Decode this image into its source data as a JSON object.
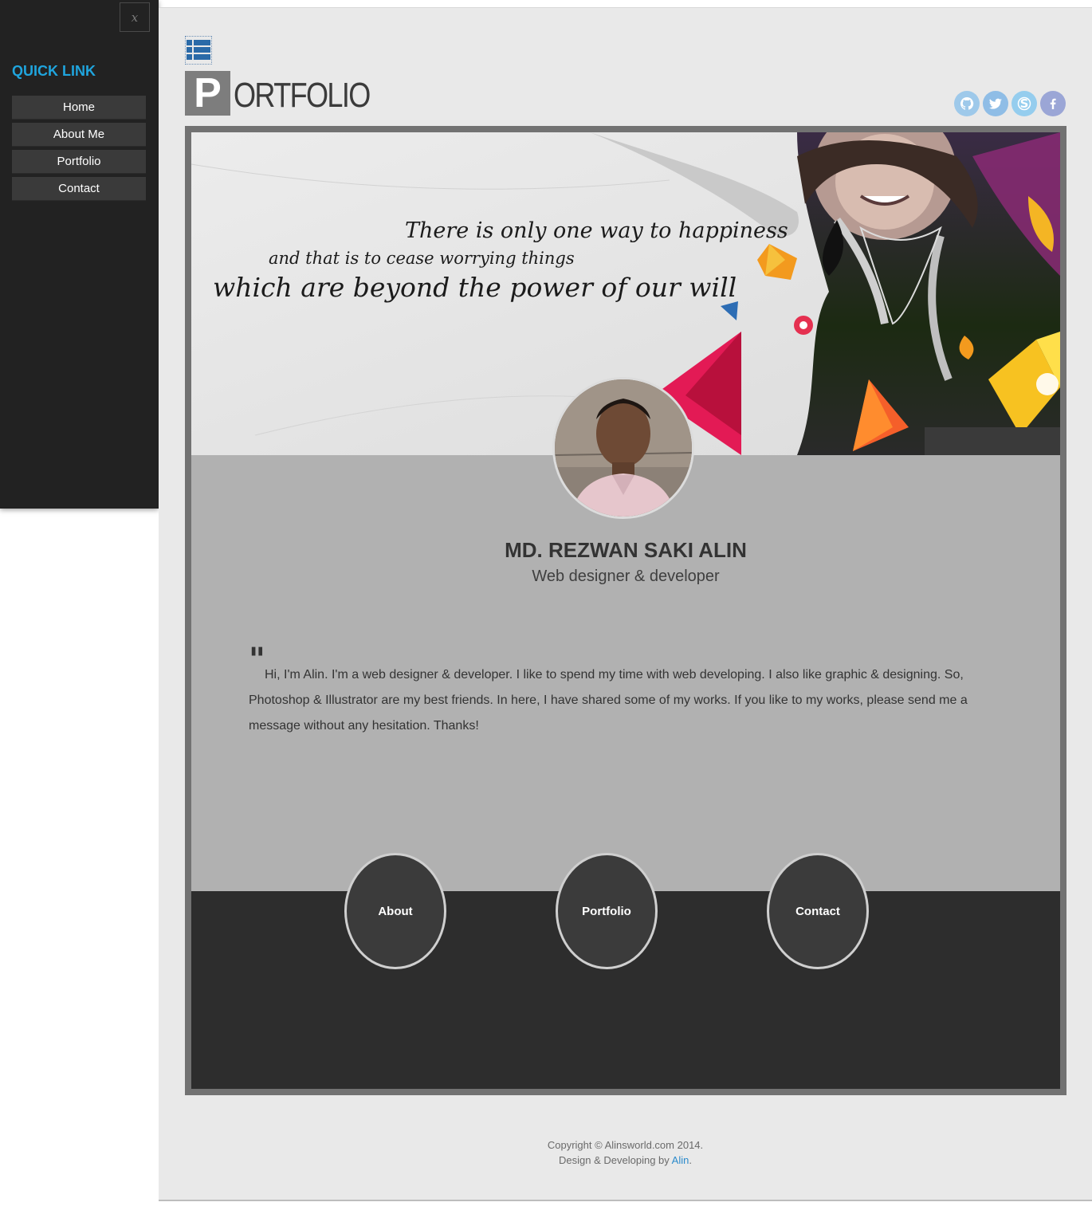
{
  "sidebar": {
    "close_label": "x",
    "title": "QUICK LINK",
    "items": [
      {
        "label": "Home"
      },
      {
        "label": "About Me"
      },
      {
        "label": "Portfolio"
      },
      {
        "label": "Contact"
      }
    ]
  },
  "header": {
    "logo_initial": "P",
    "logo_rest": "ORTFOLIO",
    "menu_icon": "list-icon",
    "social": [
      {
        "icon": "github-icon",
        "color": "#9ec9ea"
      },
      {
        "icon": "twitter-icon",
        "color": "#8fbde6"
      },
      {
        "icon": "skype-icon",
        "color": "#95cdee"
      },
      {
        "icon": "facebook-icon",
        "color": "#9ba6d6"
      }
    ]
  },
  "banner": {
    "quote_line1": "There is only one way to happiness",
    "quote_line2": "and that is to cease worrying things",
    "quote_line3": "which are beyond the power of our will"
  },
  "profile": {
    "name": "MD. REZWAN SAKI ALIN",
    "role": "Web designer & developer",
    "quote_mark": "\"",
    "bio": "Hi, I'm Alin. I'm a web designer & developer. I like to spend my time with web developing. I also like graphic & designing. So, Photoshop & Illustrator are my best friends. In here, I have shared some of my works. If you like to my works, please send me a message without any hesitation. Thanks!"
  },
  "nav_circles": [
    {
      "label": "About"
    },
    {
      "label": "Portfolio"
    },
    {
      "label": "Contact"
    }
  ],
  "footer": {
    "copyright": "Copyright © Alinsworld.com 2014.",
    "credit_prefix": "Design & Developing by ",
    "credit_link": "Alin",
    "credit_suffix": "."
  },
  "colors": {
    "accent": "#1fa5de",
    "sidebar_bg": "#222222",
    "link": "#2b8acb"
  }
}
